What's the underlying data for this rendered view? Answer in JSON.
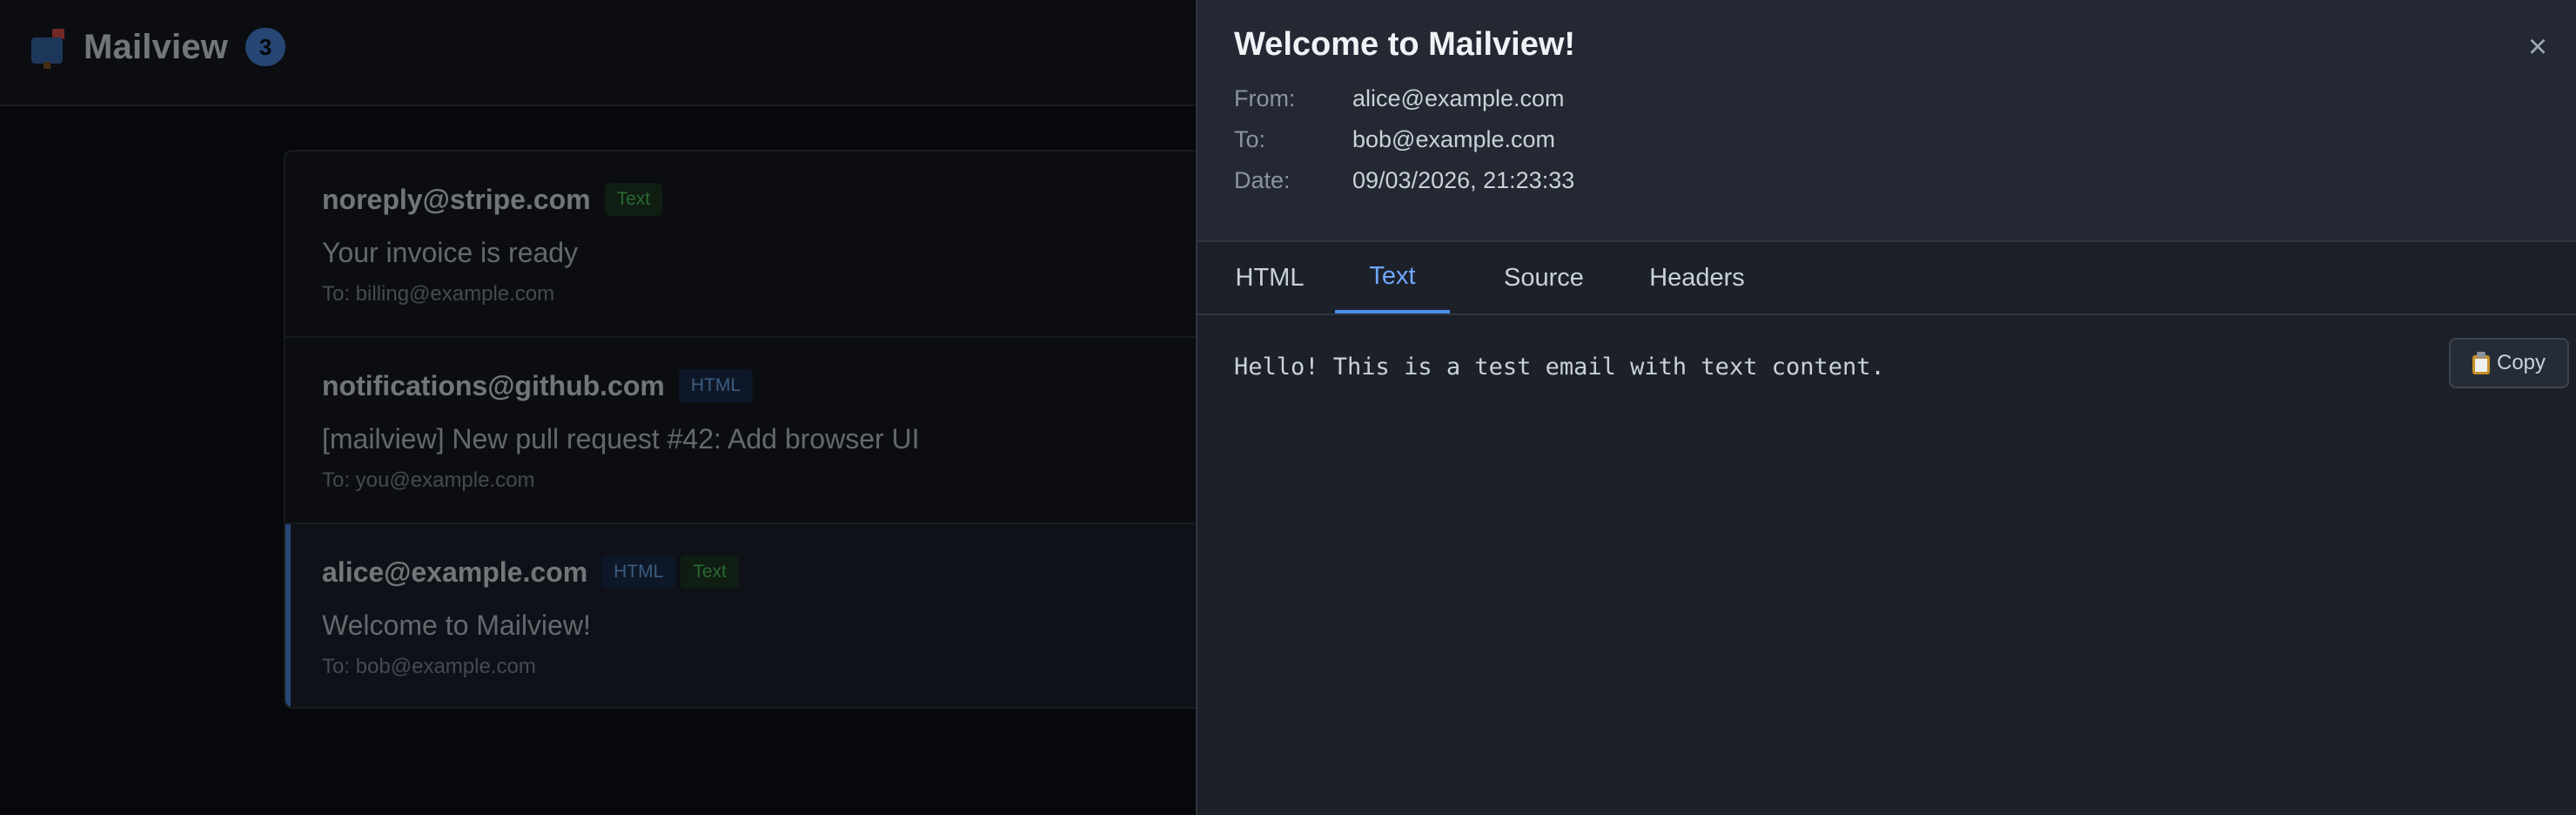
{
  "app": {
    "title": "Mailview",
    "icon": "mailbox-icon",
    "message_count": "3"
  },
  "messages": [
    {
      "sender": "noreply@stripe.com",
      "tags": [
        "Text"
      ],
      "subject": "Your invoice is ready",
      "recipient": "To: billing@example.com",
      "selected": false
    },
    {
      "sender": "notifications@github.com",
      "tags": [
        "HTML"
      ],
      "subject": "[mailview] New pull request #42: Add browser UI",
      "recipient": "To: you@example.com",
      "selected": false
    },
    {
      "sender": "alice@example.com",
      "tags": [
        "HTML",
        "Text"
      ],
      "subject": "Welcome to Mailview!",
      "recipient": "To: bob@example.com",
      "selected": true
    }
  ],
  "detail": {
    "title": "Welcome to Mailview!",
    "close_label": "×",
    "meta": {
      "from_label": "From:",
      "from_value": "alice@example.com",
      "to_label": "To:",
      "to_value": "bob@example.com",
      "date_label": "Date:",
      "date_value": "09/03/2026, 21:23:33"
    },
    "tabs": [
      {
        "label": "HTML",
        "active": false
      },
      {
        "label": "Text",
        "active": true
      },
      {
        "label": "Source",
        "active": false
      },
      {
        "label": "Headers",
        "active": false
      }
    ],
    "body": "Hello! This is a test email with text content.",
    "copy_label": "Copy"
  },
  "colors": {
    "accent": "#4c8ee8",
    "background": "#0d1117",
    "panel": "#1c2029",
    "tag_text": "#56d364",
    "tag_html": "#79b8ff"
  }
}
